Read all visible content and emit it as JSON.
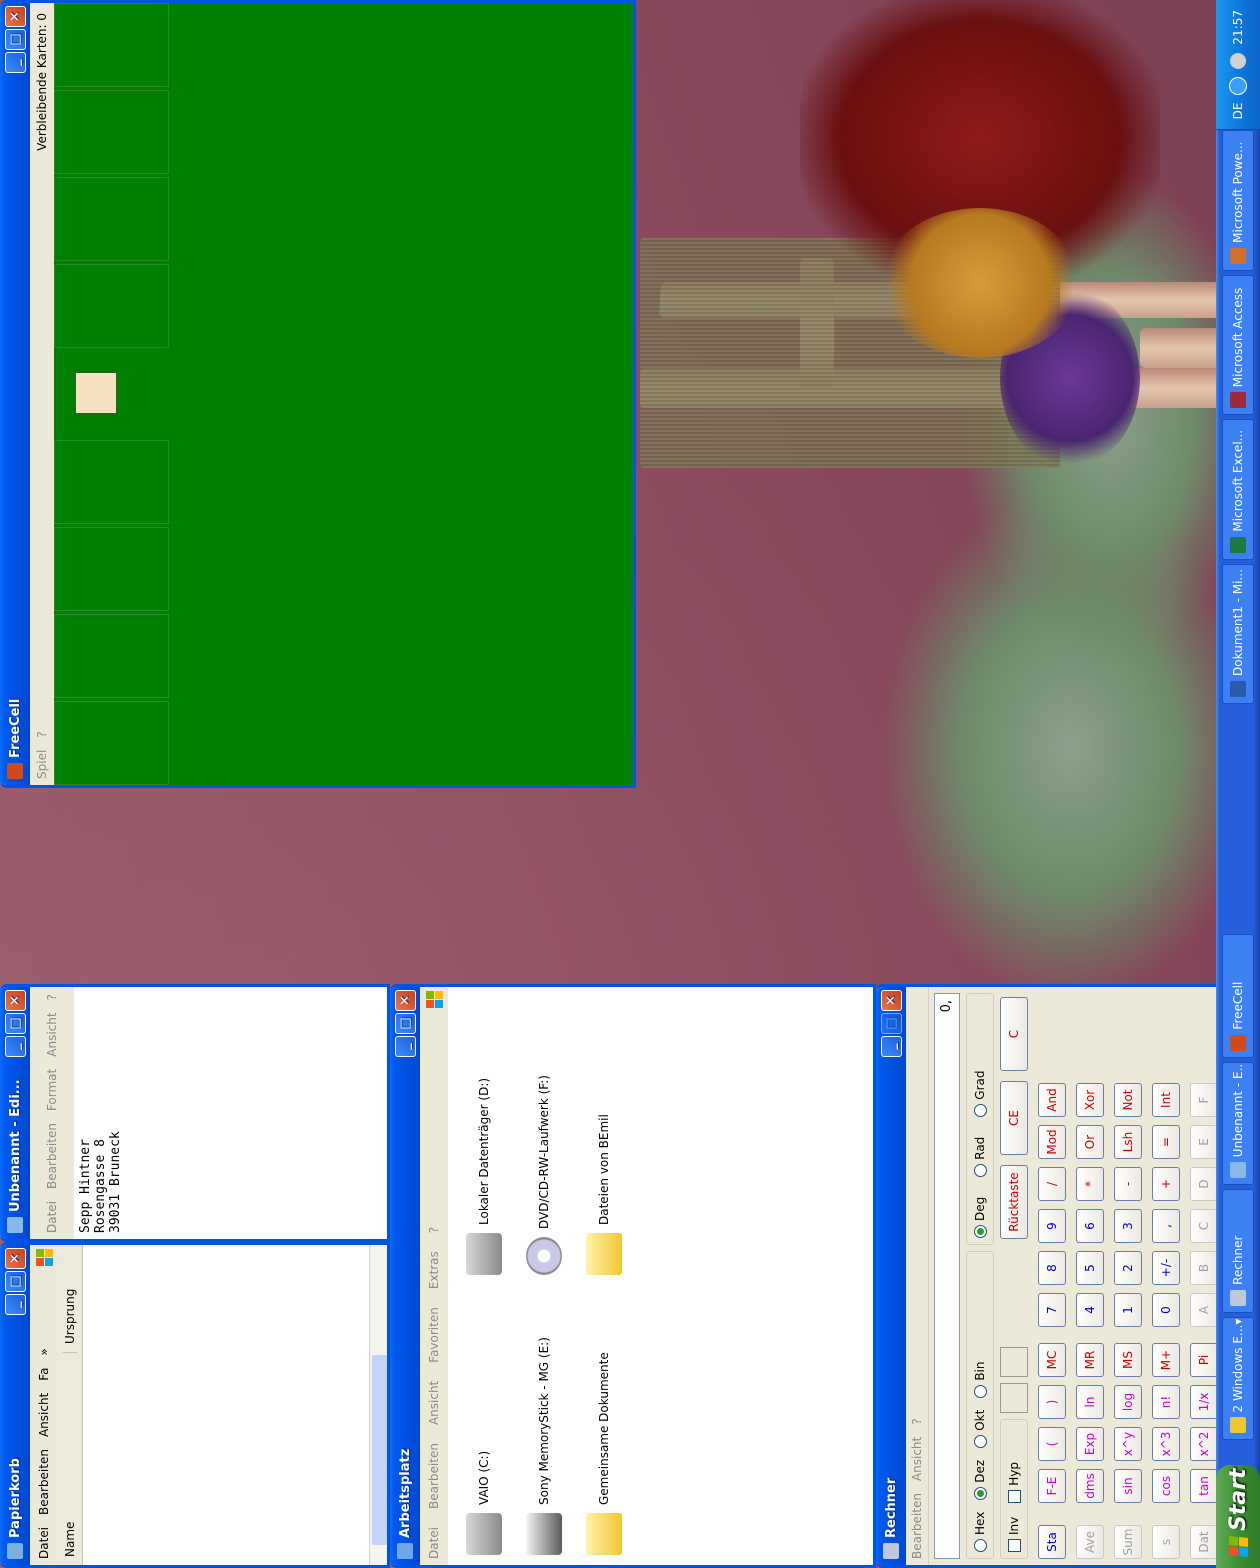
{
  "taskbar": {
    "start_label": "Start",
    "buttons": [
      {
        "label": "2 Windows E...",
        "arrow": "▾"
      },
      {
        "label": "Rechner"
      },
      {
        "label": "Unbenannt - E..."
      },
      {
        "label": "FreeCell"
      },
      {
        "label": "Dokument1 - Mi..."
      },
      {
        "label": "Microsoft Excel..."
      },
      {
        "label": "Microsoft Access"
      },
      {
        "label": "Microsoft Powe..."
      }
    ],
    "tray": {
      "language": "DE",
      "time": "21:57"
    }
  },
  "freecell": {
    "title": "FreeCell",
    "menu": [
      "Spiel",
      "?"
    ],
    "status": "Verbleibende Karten: 0"
  },
  "papierkorb": {
    "title": "Papierkorb",
    "menu": [
      "Datei",
      "Bearbeiten",
      "Ansicht",
      "Fa",
      "»"
    ],
    "columns": [
      "Name",
      "Ursprung"
    ]
  },
  "editor": {
    "title": "Unbenannt - Edi...",
    "menu": [
      "Datei",
      "Bearbeiten",
      "Format",
      "Ansicht",
      "?"
    ],
    "lines": [
      "Sepp Hintner",
      "Rosengasse 8",
      "39031 Bruneck"
    ]
  },
  "arbeitsplatz": {
    "title": "Arbeitsplatz",
    "menu": [
      "Datei",
      "Bearbeiten",
      "Ansicht",
      "Favoriten",
      "Extras",
      "?"
    ],
    "items": [
      "VAIO (C:)",
      "Lokaler Datenträger (D:)",
      "Sony MemoryStick - MG (E:)",
      "DVD/CD-RW-Laufwerk (F:)",
      "Gemeinsame Dokumente",
      "Dateien von BEmil"
    ]
  },
  "rechner": {
    "title": "Rechner",
    "menu": [
      "Bearbeiten",
      "Ansicht",
      "?"
    ],
    "display": "0,",
    "bases": [
      "Hex",
      "Dez",
      "Okt",
      "Bin"
    ],
    "angles": [
      "Deg",
      "Rad",
      "Grad"
    ],
    "checks": [
      "Inv",
      "Hyp"
    ],
    "top_keys": [
      "Rücktaste",
      "CE",
      "C"
    ],
    "rows": [
      [
        "Sta",
        "F-E",
        "(",
        ")",
        "MC",
        "7",
        "8",
        "9",
        "/",
        "Mod",
        "And"
      ],
      [
        "Ave",
        "dms",
        "Exp",
        "ln",
        "MR",
        "4",
        "5",
        "6",
        "*",
        "Or",
        "Xor"
      ],
      [
        "Sum",
        "sin",
        "x^y",
        "log",
        "MS",
        "1",
        "2",
        "3",
        "-",
        "Lsh",
        "Not"
      ],
      [
        "s",
        "cos",
        "x^3",
        "n!",
        "M+",
        "0",
        "+/-",
        ",",
        "+",
        "=",
        "Int"
      ],
      [
        "Dat",
        "tan",
        "x^2",
        "1/x",
        "Pi",
        "A",
        "B",
        "C",
        "D",
        "E",
        "F"
      ]
    ]
  },
  "colors": {
    "felt": "#008000",
    "xp_blue": "#0054e3",
    "taskbar": "#245edb",
    "start_green": "#3c8f33"
  }
}
